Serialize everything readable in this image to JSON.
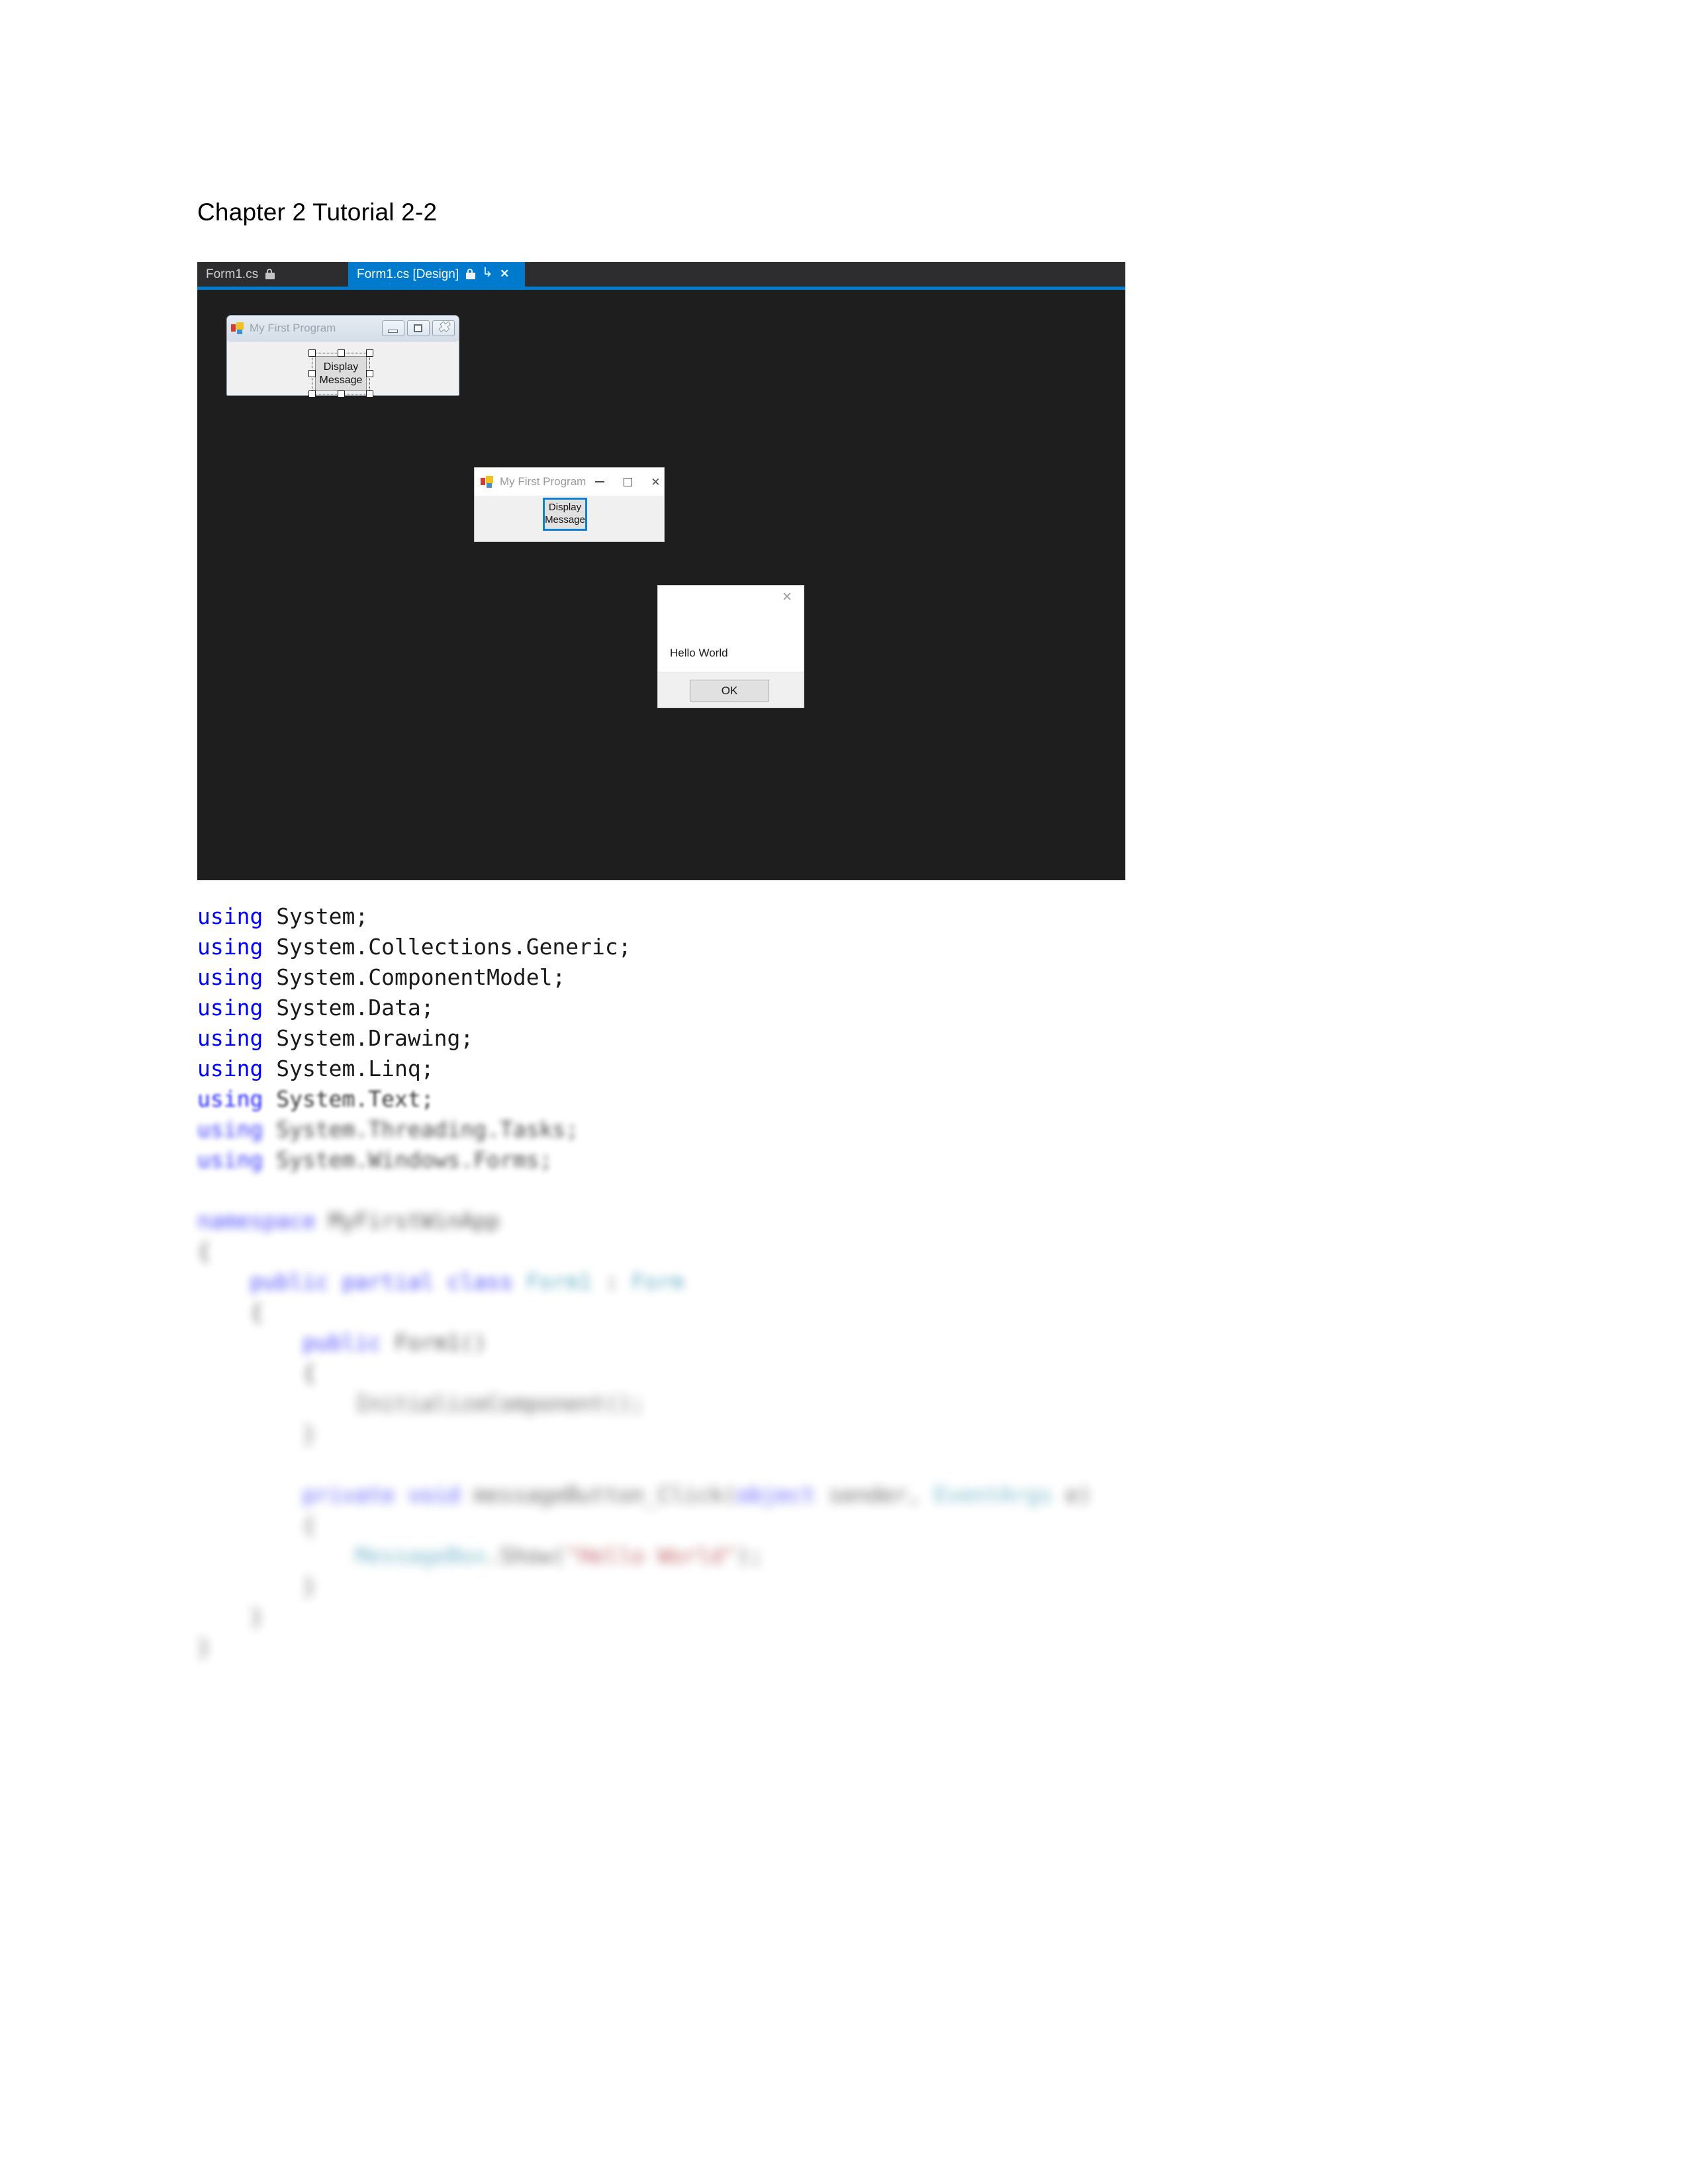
{
  "document": {
    "heading": "Chapter 2 Tutorial 2-2"
  },
  "colors": {
    "vs_accent": "#007acc",
    "vs_tabstrip": "#2d2d30",
    "vs_canvas": "#1e1e1e",
    "focus_blue": "#0f7fd6",
    "keyword": "#0000ff",
    "type": "#2b91af",
    "string": "#a31515"
  },
  "vs_window": {
    "tabs": [
      {
        "label": "Form1.cs",
        "active": false,
        "icons": [
          "lock-icon"
        ]
      },
      {
        "label": "Form1.cs [Design]",
        "active": true,
        "icons": [
          "lock-icon",
          "pin-icon",
          "close-icon"
        ]
      }
    ]
  },
  "designer_form": {
    "title": "My First Program",
    "app_icon": "visual-studio-icon",
    "window_buttons": [
      "minimize",
      "maximize",
      "close"
    ],
    "selected_control": {
      "label_line1": "Display",
      "label_line2": "Message",
      "selected": true,
      "handles": 8
    }
  },
  "running_form": {
    "title": "My First Program",
    "app_icon": "visual-studio-icon",
    "window_buttons": [
      "minimize",
      "maximize",
      "close"
    ],
    "button": {
      "label_line1": "Display",
      "label_line2": "Message",
      "focused": true
    }
  },
  "message_box": {
    "message": "Hello World",
    "ok_label": "OK",
    "close_icon": "close-icon"
  },
  "code_listing": {
    "lines": [
      {
        "indent": 0,
        "blur": 0,
        "tokens": [
          {
            "t": "using",
            "c": "kw"
          },
          {
            "t": " System;",
            "c": ""
          }
        ]
      },
      {
        "indent": 0,
        "blur": 0,
        "tokens": [
          {
            "t": "using",
            "c": "kw"
          },
          {
            "t": " System.Collections.Generic;",
            "c": ""
          }
        ]
      },
      {
        "indent": 0,
        "blur": 0,
        "tokens": [
          {
            "t": "using",
            "c": "kw"
          },
          {
            "t": " System.ComponentModel;",
            "c": ""
          }
        ]
      },
      {
        "indent": 0,
        "blur": 0,
        "tokens": [
          {
            "t": "using",
            "c": "kw"
          },
          {
            "t": " System.Data;",
            "c": ""
          }
        ]
      },
      {
        "indent": 0,
        "blur": 0,
        "tokens": [
          {
            "t": "using",
            "c": "kw"
          },
          {
            "t": " System.Drawing;",
            "c": ""
          }
        ]
      },
      {
        "indent": 0,
        "blur": 0,
        "tokens": [
          {
            "t": "using",
            "c": "kw"
          },
          {
            "t": " System.Linq;",
            "c": ""
          }
        ]
      },
      {
        "indent": 0,
        "blur": 1,
        "tokens": [
          {
            "t": "using",
            "c": "kw"
          },
          {
            "t": " System.Text;",
            "c": ""
          }
        ]
      },
      {
        "indent": 0,
        "blur": 2,
        "tokens": [
          {
            "t": "using",
            "c": "kw"
          },
          {
            "t": " System.Threading.Tasks;",
            "c": ""
          }
        ]
      },
      {
        "indent": 0,
        "blur": 2,
        "tokens": [
          {
            "t": "using",
            "c": "kw"
          },
          {
            "t": " System.Windows.Forms;",
            "c": ""
          }
        ]
      },
      {
        "indent": 0,
        "blur": 0,
        "tokens": [
          {
            "t": "",
            "c": ""
          }
        ]
      },
      {
        "indent": 0,
        "blur": 3,
        "tokens": [
          {
            "t": "namespace",
            "c": "kw"
          },
          {
            "t": " MyFirstWinApp",
            "c": ""
          }
        ]
      },
      {
        "indent": 0,
        "blur": 3,
        "tokens": [
          {
            "t": "{",
            "c": ""
          }
        ]
      },
      {
        "indent": 1,
        "blur": 3,
        "tokens": [
          {
            "t": "public",
            "c": "kw"
          },
          {
            "t": " ",
            "c": ""
          },
          {
            "t": "partial",
            "c": "kw"
          },
          {
            "t": " ",
            "c": ""
          },
          {
            "t": "class",
            "c": "kw"
          },
          {
            "t": " ",
            "c": ""
          },
          {
            "t": "Form1",
            "c": "type"
          },
          {
            "t": " : ",
            "c": ""
          },
          {
            "t": "Form",
            "c": "type"
          }
        ]
      },
      {
        "indent": 1,
        "blur": 3,
        "tokens": [
          {
            "t": "{",
            "c": ""
          }
        ]
      },
      {
        "indent": 2,
        "blur": 3,
        "tokens": [
          {
            "t": "public",
            "c": "kw"
          },
          {
            "t": " Form1()",
            "c": ""
          }
        ]
      },
      {
        "indent": 2,
        "blur": 3,
        "tokens": [
          {
            "t": "{",
            "c": ""
          }
        ]
      },
      {
        "indent": 3,
        "blur": 4,
        "tokens": [
          {
            "t": "InitializeComponent();",
            "c": ""
          }
        ]
      },
      {
        "indent": 2,
        "blur": 4,
        "tokens": [
          {
            "t": "}",
            "c": ""
          }
        ]
      },
      {
        "indent": 0,
        "blur": 0,
        "tokens": [
          {
            "t": "",
            "c": ""
          }
        ]
      },
      {
        "indent": 2,
        "blur": 4,
        "tokens": [
          {
            "t": "private",
            "c": "kw"
          },
          {
            "t": " ",
            "c": ""
          },
          {
            "t": "void",
            "c": "kw"
          },
          {
            "t": " messageButton_Click(",
            "c": ""
          },
          {
            "t": "object",
            "c": "kw"
          },
          {
            "t": " sender, ",
            "c": ""
          },
          {
            "t": "EventArgs",
            "c": "type"
          },
          {
            "t": " e)",
            "c": ""
          }
        ]
      },
      {
        "indent": 2,
        "blur": 4,
        "tokens": [
          {
            "t": "{",
            "c": ""
          }
        ]
      },
      {
        "indent": 3,
        "blur": 4,
        "tokens": [
          {
            "t": "MessageBox",
            "c": "type"
          },
          {
            "t": ".Show(",
            "c": ""
          },
          {
            "t": "\"Hello World\"",
            "c": "str"
          },
          {
            "t": ");",
            "c": ""
          }
        ]
      },
      {
        "indent": 2,
        "blur": 4,
        "tokens": [
          {
            "t": "}",
            "c": ""
          }
        ]
      },
      {
        "indent": 1,
        "blur": 4,
        "tokens": [
          {
            "t": "}",
            "c": ""
          }
        ]
      },
      {
        "indent": 0,
        "blur": 4,
        "tokens": [
          {
            "t": "}",
            "c": ""
          }
        ]
      }
    ]
  }
}
